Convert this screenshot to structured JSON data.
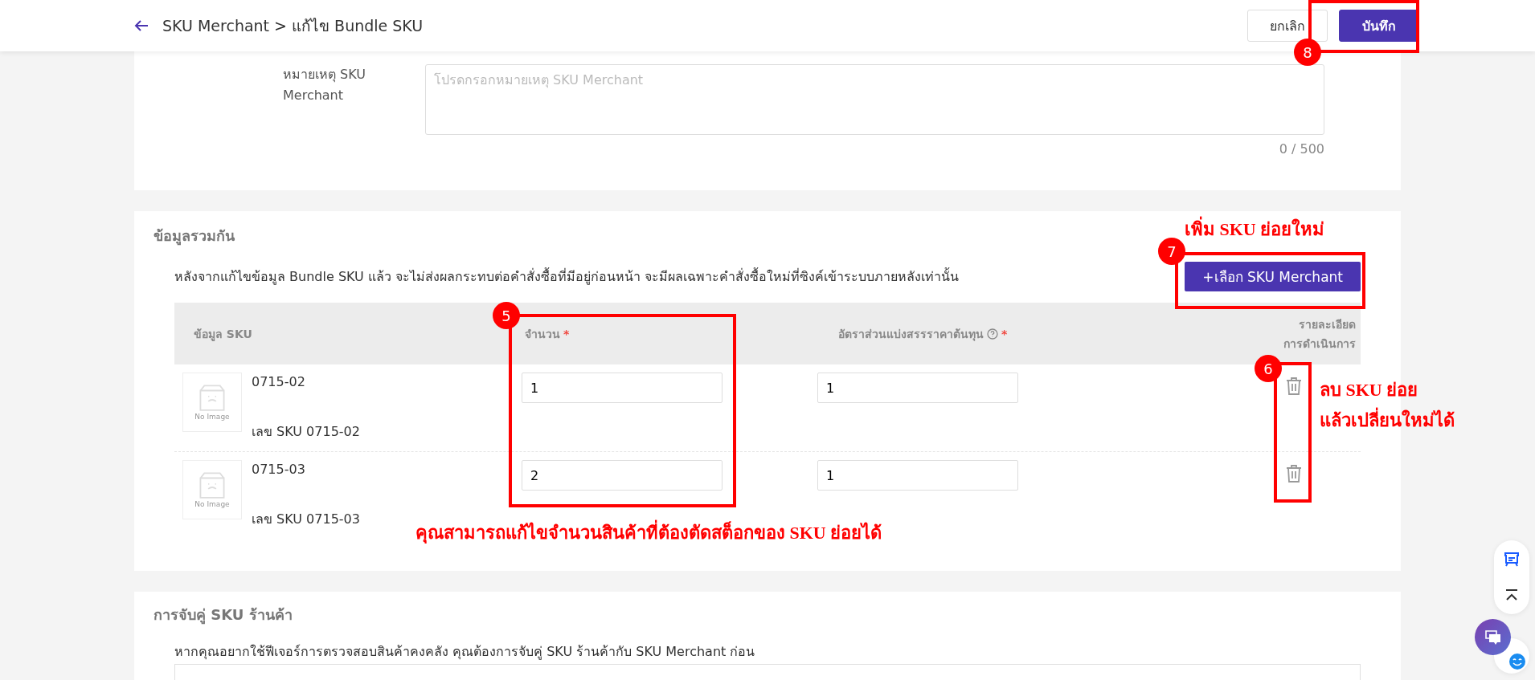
{
  "header": {
    "title": "SKU Merchant > แก้ไข Bundle SKU",
    "buttons": [
      {
        "label": "ยกเลิก",
        "kind": "secondary"
      },
      {
        "label": "บันทึก",
        "kind": "primary"
      }
    ]
  },
  "remark": {
    "label": "หมายเหตุ SKU Merchant",
    "placeholder": "โปรดกรอกหมายเหตุ SKU Merchant",
    "counter": "0 / 500"
  },
  "bundle": {
    "title": "ข้อมูลรวมกัน",
    "note": "หลังจากแก้ไขข้อมูล Bundle SKU แล้ว จะไม่ส่งผลกระทบต่อคำสั่งซื้อที่มีอยู่ก่อนหน้า จะมีผลเฉพาะคำสั่งซื้อใหม่ที่ซิงค์เข้าระบบภายหลังเท่านั้น",
    "add_button": "+เลือก SKU Merchant",
    "columns": [
      {
        "lines": [
          "ข้อมูล SKU"
        ]
      },
      {
        "lines": [
          "จำนวน"
        ],
        "mark": "*"
      },
      {
        "lines": [
          "อัตราส่วนแบ่งสรรราคาต้นทุน"
        ],
        "mark": "*",
        "help": true
      },
      {
        "lines": [
          "รายละเอียด",
          "การดำเนินการ"
        ]
      }
    ],
    "rows": [
      {
        "name": "0715-02",
        "sku": "เลข SKU 0715-02",
        "image_text": "No Image",
        "quantity": "1",
        "ratio": "1"
      },
      {
        "name": "0715-03",
        "sku": "เลข SKU 0715-03",
        "image_text": "No Image",
        "quantity": "2",
        "ratio": "1"
      }
    ]
  },
  "store_mapping": {
    "title": "การจับคู่ SKU ร้านค้า",
    "note": "หากคุณอยากใช้ฟีเจอร์การตรวจสอบสินค้าคงคลัง คุณต้องการจับคู่ SKU ร้านค้ากับ SKU Merchant ก่อน"
  },
  "annotations": [
    {
      "number": "8"
    },
    {
      "number": "7",
      "lines": [
        "เพิ่ม SKU ย่อยใหม่"
      ]
    },
    {
      "number": "5",
      "lines": [
        "คุณสามารถแก้ไขจำนวนสินค้าที่ต้องตัดสต็อกของ SKU ย่อยได้"
      ]
    },
    {
      "number": "6",
      "lines": [
        "ลบ SKU ย่อย",
        "แล้วเปลี่ยนใหม่ได้"
      ]
    }
  ]
}
